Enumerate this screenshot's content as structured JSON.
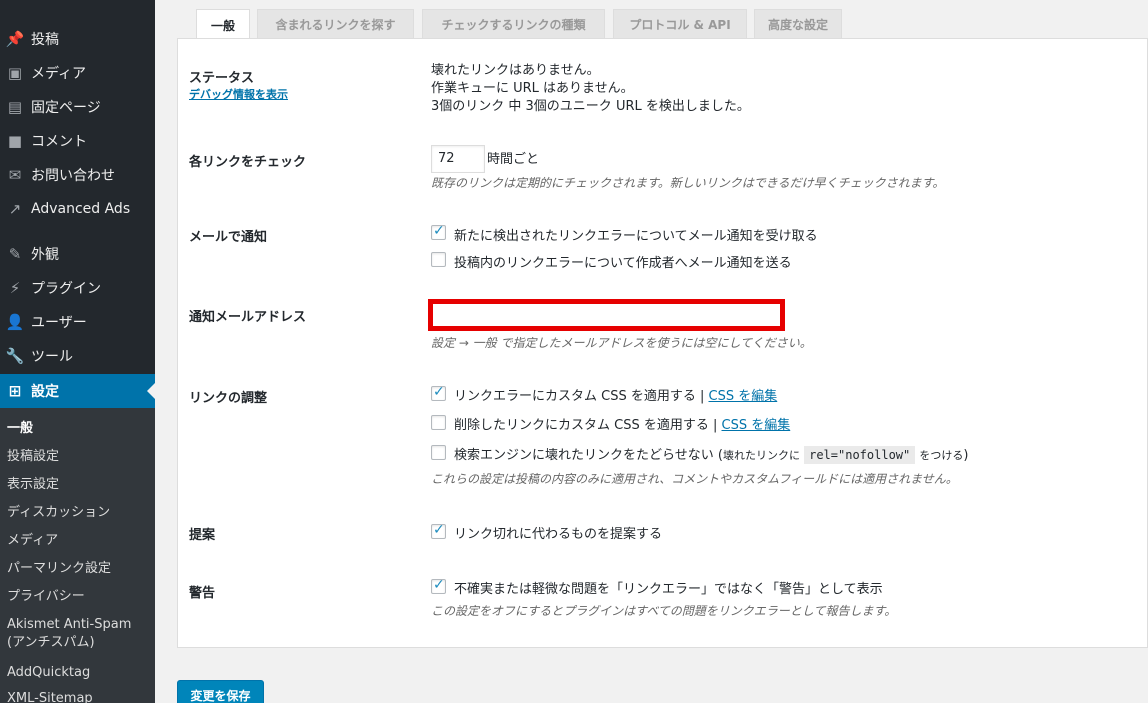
{
  "sidebar": {
    "items": [
      {
        "label": "投稿",
        "icon": "pin-icon"
      },
      {
        "label": "メディア",
        "icon": "media-icon"
      },
      {
        "label": "固定ページ",
        "icon": "page-icon"
      },
      {
        "label": "コメント",
        "icon": "comment-icon"
      },
      {
        "label": "お問い合わせ",
        "icon": "mail-icon"
      },
      {
        "label": "Advanced Ads",
        "icon": "chart-icon"
      },
      {
        "label": "外観",
        "icon": "brush-icon"
      },
      {
        "label": "プラグイン",
        "icon": "plugin-icon"
      },
      {
        "label": "ユーザー",
        "icon": "user-icon"
      },
      {
        "label": "ツール",
        "icon": "wrench-icon"
      },
      {
        "label": "設定",
        "icon": "settings-icon"
      }
    ],
    "submenu": [
      "一般",
      "投稿設定",
      "表示設定",
      "ディスカッション",
      "メディア",
      "パーマリンク設定",
      "プライバシー",
      "Akismet Anti-Spam",
      "(アンチスパム)",
      "AddQuicktag",
      "XML-Sitemap"
    ]
  },
  "tabs": [
    "一般",
    "含まれるリンクを探す",
    "チェックするリンクの種類",
    "プロトコル & API",
    "高度な設定"
  ],
  "status": {
    "label": "ステータス",
    "debug_link": "デバッグ情報を表示",
    "line1": "壊れたリンクはありません。",
    "line2": "作業キューに URL はありません。",
    "line3": "3個のリンク 中 3個のユニーク URL を検出しました。"
  },
  "check_interval": {
    "label": "各リンクをチェック",
    "value": "72",
    "unit": "時間ごと",
    "desc": "既存のリンクは定期的にチェックされます。新しいリンクはできるだけ早くチェックされます。"
  },
  "email_notify": {
    "label": "メールで通知",
    "opt1": "新たに検出されたリンクエラーについてメール通知を受け取る",
    "opt2": "投稿内のリンクエラーについて作成者へメール通知を送る"
  },
  "notify_email": {
    "label": "通知メールアドレス",
    "value": "",
    "desc": "設定 → 一般 で指定したメールアドレスを使うには空にしてください。"
  },
  "link_tweaks": {
    "label": "リンクの調整",
    "opt1": "リンクエラーにカスタム CSS を適用する |",
    "opt1_link": "CSS を編集",
    "opt2": "削除したリンクにカスタム CSS を適用する |",
    "opt2_link": "CSS を編集",
    "opt3": "検索エンジンに壊れたリンクをたどらせない (",
    "opt3_small": "壊れたリンクに",
    "opt3_code": "rel=\"nofollow\"",
    "opt3_small2": "をつける",
    "opt3_end": ")",
    "desc": "これらの設定は投稿の内容のみに適用され、コメントやカスタムフィールドには適用されません。"
  },
  "suggestions": {
    "label": "提案",
    "opt1": "リンク切れに代わるものを提案する"
  },
  "warnings": {
    "label": "警告",
    "opt1": "不確実または軽微な問題を「リンクエラー」ではなく「警告」として表示",
    "desc": "この設定をオフにするとプラグインはすべての問題をリンクエラーとして報告します。"
  },
  "save_label": "変更を保存"
}
